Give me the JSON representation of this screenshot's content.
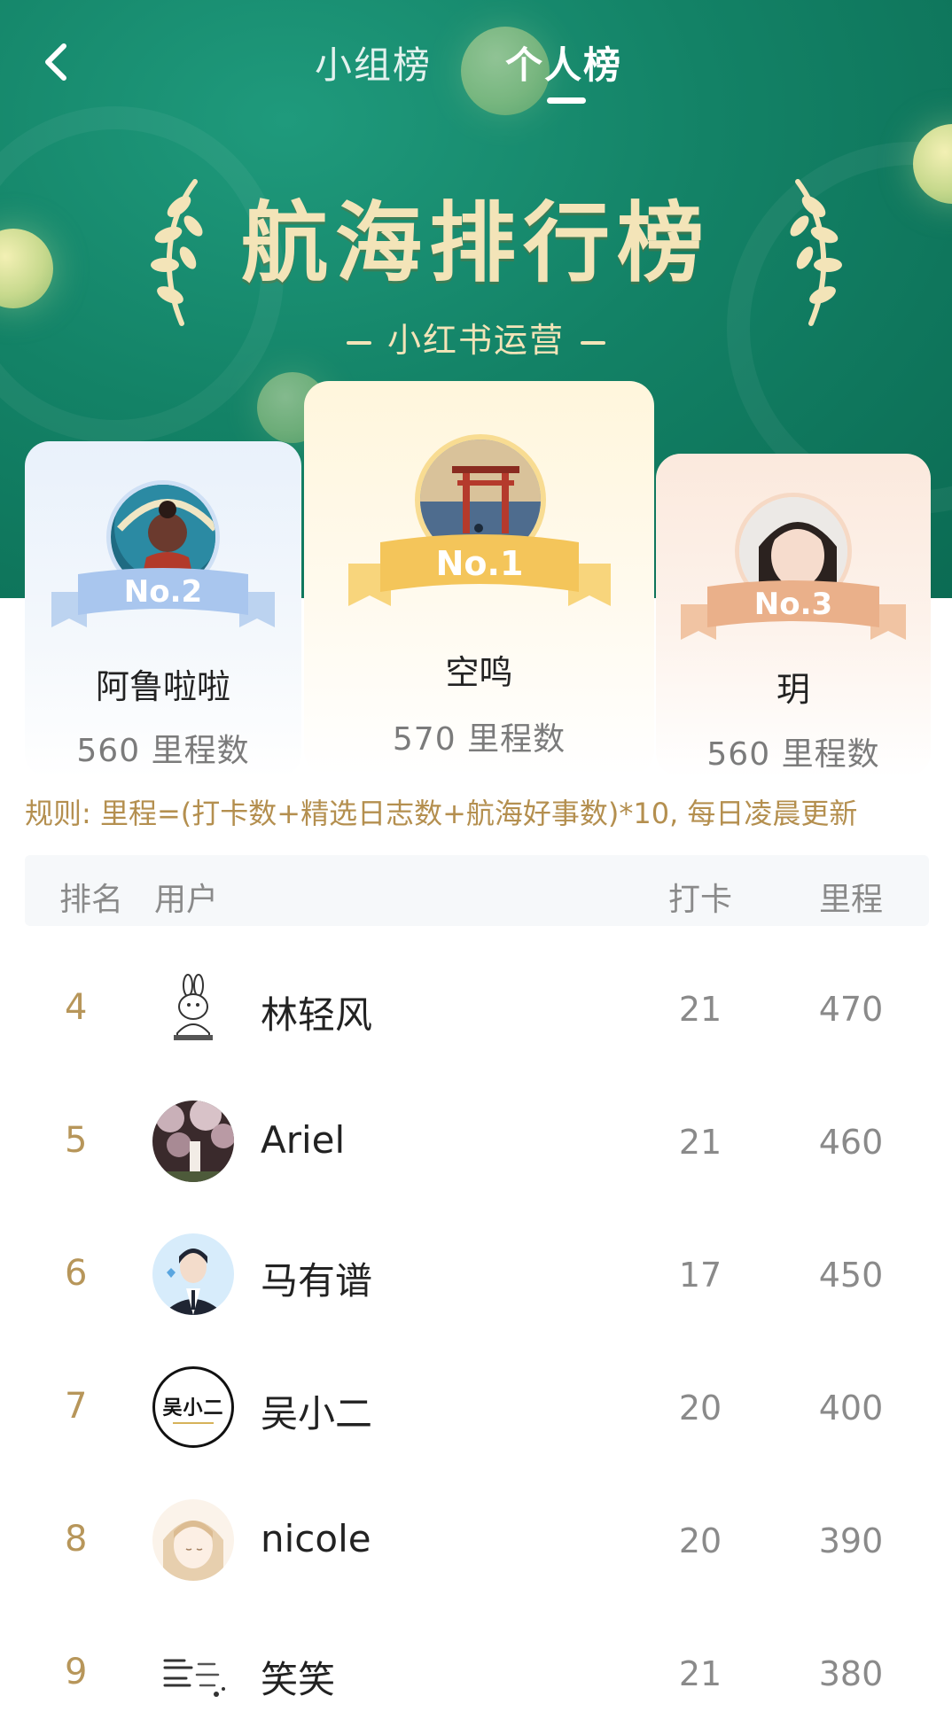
{
  "nav": {
    "back_icon": "chevron-left-icon",
    "tabs": [
      {
        "label": "小组榜",
        "active": false
      },
      {
        "label": "个人榜",
        "active": true
      }
    ]
  },
  "header": {
    "title": "航海排行榜",
    "subtitle": "小红书运营"
  },
  "podium": [
    {
      "place": "No.2",
      "name": "阿鲁啦啦",
      "score": "560 里程数",
      "ribbon_color": "#a9c6ee"
    },
    {
      "place": "No.1",
      "name": "空鸣",
      "score": "570 里程数",
      "ribbon_color": "#f4c55a"
    },
    {
      "place": "No.3",
      "name": "玥",
      "score": "560 里程数",
      "ribbon_color": "#eab08a"
    }
  ],
  "rules": "规则: 里程=(打卡数+精选日志数+航海好事数)*10, 每日凌晨更新",
  "table": {
    "headers": {
      "rank": "排名",
      "user": "用户",
      "checkin": "打卡",
      "miles": "里程"
    },
    "rows": [
      {
        "rank": "4",
        "name": "林轻风",
        "checkin": "21",
        "miles": "470"
      },
      {
        "rank": "5",
        "name": "Ariel",
        "checkin": "21",
        "miles": "460"
      },
      {
        "rank": "6",
        "name": "马有谱",
        "checkin": "17",
        "miles": "450"
      },
      {
        "rank": "7",
        "name": "吴小二",
        "checkin": "20",
        "miles": "400",
        "avatar_text": "吴小二"
      },
      {
        "rank": "8",
        "name": "nicole",
        "checkin": "20",
        "miles": "390"
      },
      {
        "rank": "9",
        "name": "笑笑",
        "checkin": "21",
        "miles": "380"
      }
    ]
  },
  "colors": {
    "hero_green": "#138266",
    "title_gold": "#f3e4b8",
    "rank_gold": "#b7965a",
    "rules_gold": "#b48f4f"
  }
}
